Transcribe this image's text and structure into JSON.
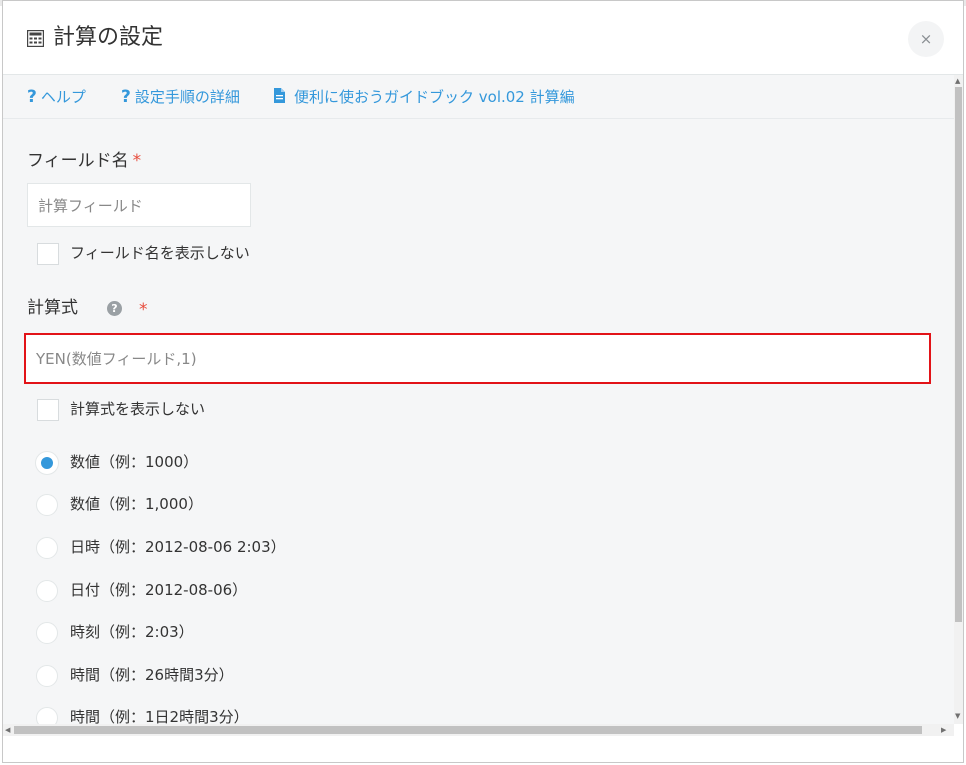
{
  "dialog": {
    "title": "計算の設定",
    "title_icon": "calculator-icon",
    "close_label": "×"
  },
  "help_links": [
    {
      "label": "ヘルプ",
      "icon": "question-icon"
    },
    {
      "label": "設定手順の詳細",
      "icon": "question-icon"
    },
    {
      "label": "便利に使おうガイドブック vol.02 計算編",
      "icon": "document-icon"
    }
  ],
  "field_name": {
    "label": "フィールド名",
    "required_mark": "*",
    "value": "計算フィールド",
    "hide_label": "フィールド名を表示しない",
    "hide_checked": false
  },
  "formula": {
    "label": "計算式",
    "help_icon": "help-circle-icon",
    "help_glyph": "?",
    "required_mark": "*",
    "value": "YEN(数値フィールド,1)",
    "hide_label": "計算式を表示しない",
    "hide_checked": false
  },
  "format_options": {
    "selected_index": 0,
    "items": [
      "数値（例：1000）",
      "数値（例：1,000）",
      "日時（例：2012-08-06 2:03）",
      "日付（例：2012-08-06）",
      "時刻（例：2:03）",
      "時間（例：26時間3分）",
      "時間（例：1日2時間3分）"
    ]
  },
  "colors": {
    "link": "#3498db",
    "required": "#e74c3c",
    "highlight_border": "#e21318",
    "panel_bg": "#f5f6f7"
  }
}
